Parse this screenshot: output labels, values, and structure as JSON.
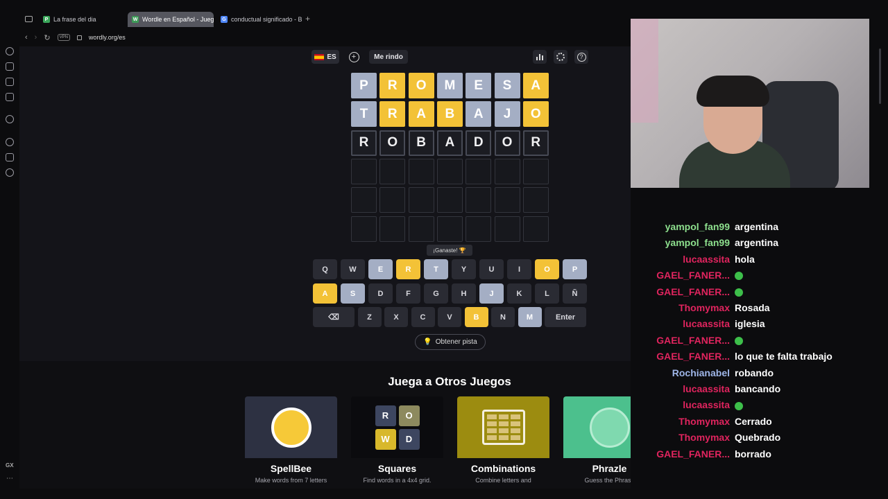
{
  "browser": {
    "tabs": [
      {
        "label": "La frase del dia",
        "icon": "P",
        "color": "#3aa65a"
      },
      {
        "label": "Wordle en Español - Jueg",
        "icon": "W",
        "color": "#3d9a57"
      },
      {
        "label": "conductual significado - B",
        "icon": "G",
        "color": "#4f86f7"
      }
    ],
    "url": "wordly.org/es",
    "vpn_label": "VPN",
    "gx_label": "GX"
  },
  "game": {
    "lang_label": "ES",
    "give_up_label": "Me rindo",
    "rows": [
      {
        "letters": [
          "P",
          "R",
          "O",
          "M",
          "E",
          "S",
          "A"
        ],
        "states": [
          "gray",
          "yellow",
          "yellow",
          "gray",
          "gray",
          "gray",
          "yellow"
        ]
      },
      {
        "letters": [
          "T",
          "R",
          "A",
          "B",
          "A",
          "J",
          "O"
        ],
        "states": [
          "gray",
          "yellow",
          "yellow",
          "yellow",
          "gray",
          "gray",
          "yellow"
        ]
      },
      {
        "letters": [
          "R",
          "O",
          "B",
          "A",
          "D",
          "O",
          "R"
        ],
        "states": [
          "typed",
          "typed",
          "typed",
          "typed",
          "typed",
          "typed",
          "typed"
        ]
      },
      {
        "letters": [
          "",
          "",
          "",
          "",
          "",
          "",
          ""
        ],
        "states": [
          "empty",
          "empty",
          "empty",
          "empty",
          "empty",
          "empty",
          "empty"
        ]
      },
      {
        "letters": [
          "",
          "",
          "",
          "",
          "",
          "",
          ""
        ],
        "states": [
          "empty",
          "empty",
          "empty",
          "empty",
          "empty",
          "empty",
          "empty"
        ]
      },
      {
        "letters": [
          "",
          "",
          "",
          "",
          "",
          "",
          ""
        ],
        "states": [
          "empty",
          "empty",
          "empty",
          "empty",
          "empty",
          "empty",
          "empty"
        ]
      }
    ],
    "toast": "¡Ganaste! 🏆",
    "keyboard": [
      [
        {
          "k": "Q",
          "s": ""
        },
        {
          "k": "W",
          "s": ""
        },
        {
          "k": "E",
          "s": "gray"
        },
        {
          "k": "R",
          "s": "yellow"
        },
        {
          "k": "T",
          "s": "gray"
        },
        {
          "k": "Y",
          "s": ""
        },
        {
          "k": "U",
          "s": ""
        },
        {
          "k": "I",
          "s": ""
        },
        {
          "k": "O",
          "s": "yellow"
        },
        {
          "k": "P",
          "s": "gray"
        }
      ],
      [
        {
          "k": "A",
          "s": "yellow"
        },
        {
          "k": "S",
          "s": "gray"
        },
        {
          "k": "D",
          "s": ""
        },
        {
          "k": "F",
          "s": ""
        },
        {
          "k": "G",
          "s": ""
        },
        {
          "k": "H",
          "s": ""
        },
        {
          "k": "J",
          "s": "gray"
        },
        {
          "k": "K",
          "s": ""
        },
        {
          "k": "L",
          "s": ""
        },
        {
          "k": "Ñ",
          "s": ""
        }
      ],
      [
        {
          "k": "⌫",
          "s": ""
        },
        {
          "k": "Z",
          "s": ""
        },
        {
          "k": "X",
          "s": ""
        },
        {
          "k": "C",
          "s": ""
        },
        {
          "k": "V",
          "s": ""
        },
        {
          "k": "B",
          "s": "yellow"
        },
        {
          "k": "N",
          "s": ""
        },
        {
          "k": "M",
          "s": "gray"
        },
        {
          "k": "Enter",
          "s": ""
        }
      ]
    ],
    "hint_label": "Obtener pista"
  },
  "other_games": {
    "title": "Juega a Otros Juegos",
    "cards": [
      {
        "name": "SpellBee",
        "desc": "Make words from 7 letters",
        "color": "#2d3142"
      },
      {
        "name": "Squares",
        "desc": "Find words in a 4x4 grid.",
        "color": "#0b0b0e",
        "tiles": [
          "R",
          "O",
          "W",
          "D"
        ]
      },
      {
        "name": "Combinations",
        "desc": "Combine letters and",
        "color": "#9c8c10"
      },
      {
        "name": "Phrazle",
        "desc": "Guess the Phrase",
        "color": "#4cc08d"
      }
    ]
  },
  "chat": [
    {
      "user": "yampol_fan99",
      "color": "#8ee08e",
      "msg": "argentina"
    },
    {
      "user": "yampol_fan99",
      "color": "#8ee08e",
      "msg": "argentina"
    },
    {
      "user": "lucaassita",
      "color": "#e0245e",
      "msg": "hola"
    },
    {
      "user": "GAEL_FANER...",
      "color": "#e0245e",
      "msg": "",
      "emote": true
    },
    {
      "user": "GAEL_FANER...",
      "color": "#e0245e",
      "msg": "",
      "emote": true
    },
    {
      "user": "Thomymax",
      "color": "#e0245e",
      "msg": "Rosada"
    },
    {
      "user": "lucaassita",
      "color": "#e0245e",
      "msg": "iglesia"
    },
    {
      "user": "GAEL_FANER...",
      "color": "#e0245e",
      "msg": "",
      "emote": true
    },
    {
      "user": "GAEL_FANER...",
      "color": "#e0245e",
      "msg": "lo que te falta trabajo"
    },
    {
      "user": "Rochianabel",
      "color": "#9fb6e8",
      "msg": "robando"
    },
    {
      "user": "lucaassita",
      "color": "#e0245e",
      "msg": "bancando"
    },
    {
      "user": "lucaassita",
      "color": "#e0245e",
      "msg": "",
      "emote": true
    },
    {
      "user": "Thomymax",
      "color": "#e0245e",
      "msg": "Cerrado"
    },
    {
      "user": "Thomymax",
      "color": "#e0245e",
      "msg": "Quebrado"
    },
    {
      "user": "GAEL_FANER...",
      "color": "#e0245e",
      "msg": "borrado"
    }
  ]
}
